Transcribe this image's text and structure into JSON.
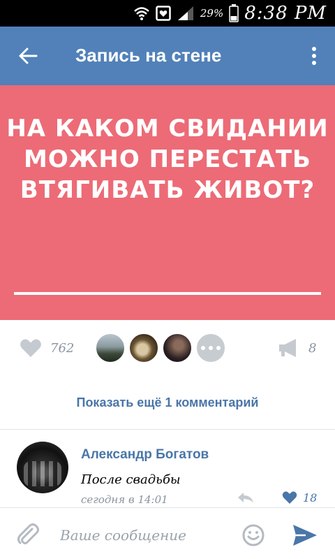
{
  "status_bar": {
    "battery_percent": "29%",
    "time": "8:38 PM",
    "icons": [
      "wifi-icon",
      "notification-icon",
      "signal-icon",
      "battery-icon"
    ]
  },
  "app_bar": {
    "title": "Запись на стене",
    "back_icon": "arrow-back-icon",
    "menu_icon": "more-vertical-icon",
    "color": "#5181b8"
  },
  "post": {
    "image_text": "НА КАКОМ СВИДАНИИ\nМОЖНО ПЕРЕСТАТЬ\nВТЯГИВАТЬ ЖИВОТ?",
    "image_bg": "#ec6b76"
  },
  "actions": {
    "likes": "762",
    "reposts": "8",
    "liker_avatars": 3,
    "icons": [
      "heart-icon",
      "more-horizontal-icon",
      "megaphone-icon"
    ]
  },
  "comments": {
    "show_more": "Показать ещё 1 комментарий",
    "items": [
      {
        "author": "Александр Богатов",
        "text": "После свадьбы",
        "time": "сегодня в 14:01",
        "likes": "18"
      }
    ]
  },
  "composer": {
    "placeholder": "Ваше сообщение",
    "icons": [
      "paperclip-icon",
      "smiley-icon",
      "send-icon"
    ]
  },
  "colors": {
    "accent": "#4a76a8",
    "muted": "#9aa3ad"
  }
}
